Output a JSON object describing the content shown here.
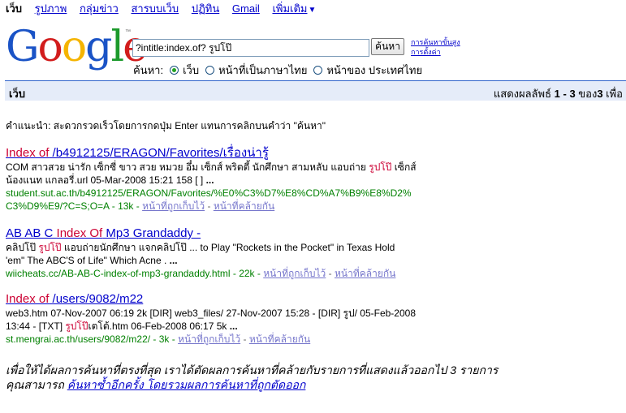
{
  "topnav": {
    "items": [
      "เว็บ",
      "รูปภาพ",
      "กลุ่มข่าว",
      "สารบบเว็บ",
      "ปฏิทิน",
      "Gmail",
      "เพิ่มเติม"
    ],
    "more_arrow": "▼"
  },
  "logo": {
    "letters": [
      "G",
      "o",
      "o",
      "g",
      "l",
      "e"
    ],
    "colors": [
      "#1a53c6",
      "#d21c1c",
      "#f5b400",
      "#1a53c6",
      "#1c9a2c",
      "#d21c1c"
    ],
    "tm": "™"
  },
  "search": {
    "query": "?intitle:index.of? รูปโป๊",
    "button": "ค้นหา",
    "advanced": "การค้นหาขั้นสูง",
    "preferences": "การตั้งค่า",
    "label": "ค้นหา:",
    "options": [
      "เว็บ",
      "หน้าที่เป็นภาษาไทย",
      "หน้าของ ประเทศไทย"
    ]
  },
  "bar": {
    "left": "เว็บ",
    "prefix": "แสดงผลลัพธ์ ",
    "range": "1 - 3",
    "of": " ของ",
    "total": "3",
    "suffix": " เพื่อ"
  },
  "tip": "คำแนะนำ: สะดวกรวดเร็วโดยการกดปุ่ม Enter แทนการคลิกบนคำว่า \"ค้นหา\"",
  "results": [
    {
      "title_hit": "Index of",
      "title_rest": " /b4912125/ERAGON/Favorites/เรื่องน่ารู้",
      "snip1_a": "COM สาวสวย น่ารัก เซ็กซี่ ขาว สวย หมวย อึ๋ม เซ็กส์ พริตตี้ นักศึกษา สามหลับ แอบถ่าย ",
      "snip1_hit": "รูปโป๊",
      "snip1_b": " เซ็กส์",
      "snip2": "น้องแนท แกลอรี่.url 05-Mar-2008 15:21 158 [ ] ",
      "ellipsis": "...",
      "url1": "student.sut.ac.th/b4912125/ERAGON/Favorites/%E0%C3%D7%E8%CD%A7%B9%E8%D2%",
      "url2": "C3%D9%E9/?C=S;O=A - 13k - ",
      "cached": "หน้าที่ถูกเก็บไว้",
      "dash": " - ",
      "similar": "หน้าที่คล้ายกัน"
    },
    {
      "title_a": "AB AB C ",
      "title_hit": "Index Of",
      "title_rest": " Mp3 Grandaddy -",
      "snip1_a": "คลิปโป๊ ",
      "snip1_hit": "รูปโป๊",
      "snip1_b": " แอบถ่ายนักศึกษา แจกคลิปโป๊ ... to Play \"Rockets in the Pocket\" in Texas Hold",
      "snip2": "'em\" The ABC'S of Life\" Which Acne . ",
      "ellipsis": "...",
      "url1": "wiicheats.cc/AB-AB-C-index-of-mp3-grandaddy.html - 22k - ",
      "cached": "หน้าที่ถูกเก็บไว้",
      "dash": " - ",
      "similar": "หน้าที่คล้ายกัน"
    },
    {
      "title_hit": "Index of",
      "title_rest": " /users/9082/m22",
      "snip1": "web3.htm 07-Nov-2007 06:19 2k [DIR] web3_files/ 27-Nov-2007 15:28 - [DIR] รูป/ 05-Feb-2008",
      "snip2_a": "13:44 - [TXT] ",
      "snip2_hit": "รูปโป๊",
      "snip2_b": "เตโต้.htm 06-Feb-2008 06:17 5k ",
      "ellipsis": "...",
      "url1": "st.mengrai.ac.th/users/9082/m22/ - 3k - ",
      "cached": "หน้าที่ถูกเก็บไว้",
      "dash": " - ",
      "similar": "หน้าที่คล้ายกัน"
    }
  ],
  "footer": {
    "line1": "เพื่อให้ได้ผลการค้นหาที่ตรงที่สุด เราได้ตัดผลการค้นหาที่คล้ายกับรายการที่แสดงแล้วออกไป 3 รายการ",
    "line2_prefix": "คุณสามารถ ",
    "line2_link": "ค้นหาซ้ำอีกครั้ง โดยรวมผลการค้นหาที่ถูกตัดออก"
  }
}
